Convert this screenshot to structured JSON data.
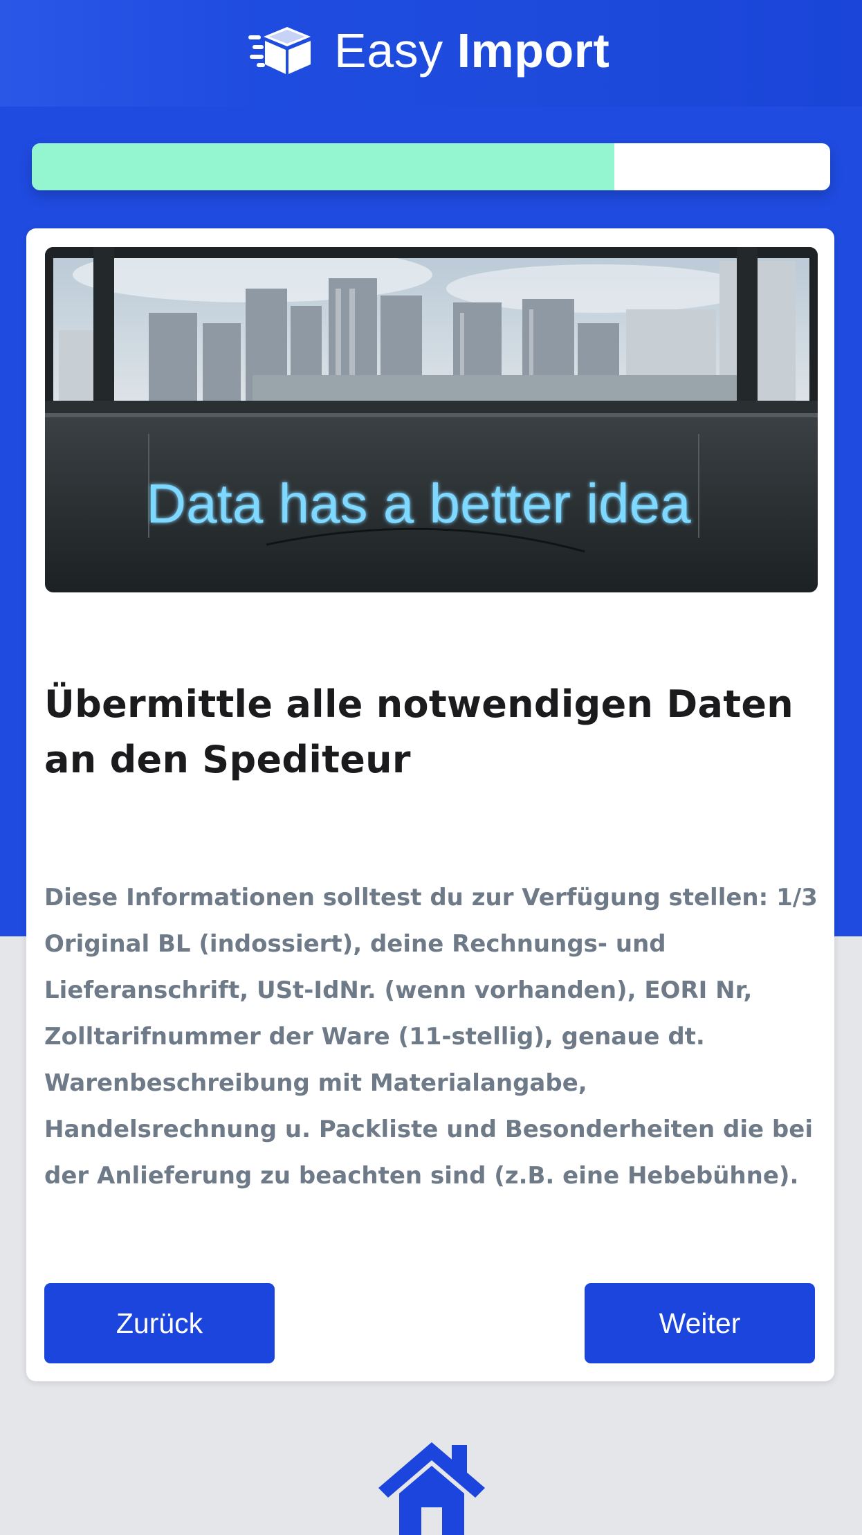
{
  "app": {
    "name_light": "Easy",
    "name_bold": "Import",
    "logo_icon": "flying-box-icon"
  },
  "progress": {
    "value_percent": 73
  },
  "hero": {
    "image": "neon-sign-city-window-photo",
    "neon_text": "Data has a better idea"
  },
  "content": {
    "title": "Übermittle alle notwendigen Daten an den Spediteur",
    "description": "Diese Informationen solltest du zur Verfügung stellen: 1/3 Original BL (indossiert), deine Rechnungs- und Lieferanschrift, USt-IdNr. (wenn vorhanden), EORI Nr, Zolltarifnummer der Ware (11-stellig), genaue dt. Warenbeschreibung mit Materialangabe, Handelsrechnung u. Packliste und Besonderheiten die bei der Anlieferung zu beachten sind (z.B. eine Hebebühne)."
  },
  "buttons": {
    "back_label": "Zurück",
    "next_label": "Weiter"
  },
  "footer": {
    "home_icon": "home-icon"
  },
  "colors": {
    "primary": "#1f4be0",
    "button": "#1b45dc",
    "progress": "#94f6d0",
    "page_bg": "#e4e6ea",
    "text_dark": "#1b1b1e",
    "text_muted": "#6e7a88"
  }
}
